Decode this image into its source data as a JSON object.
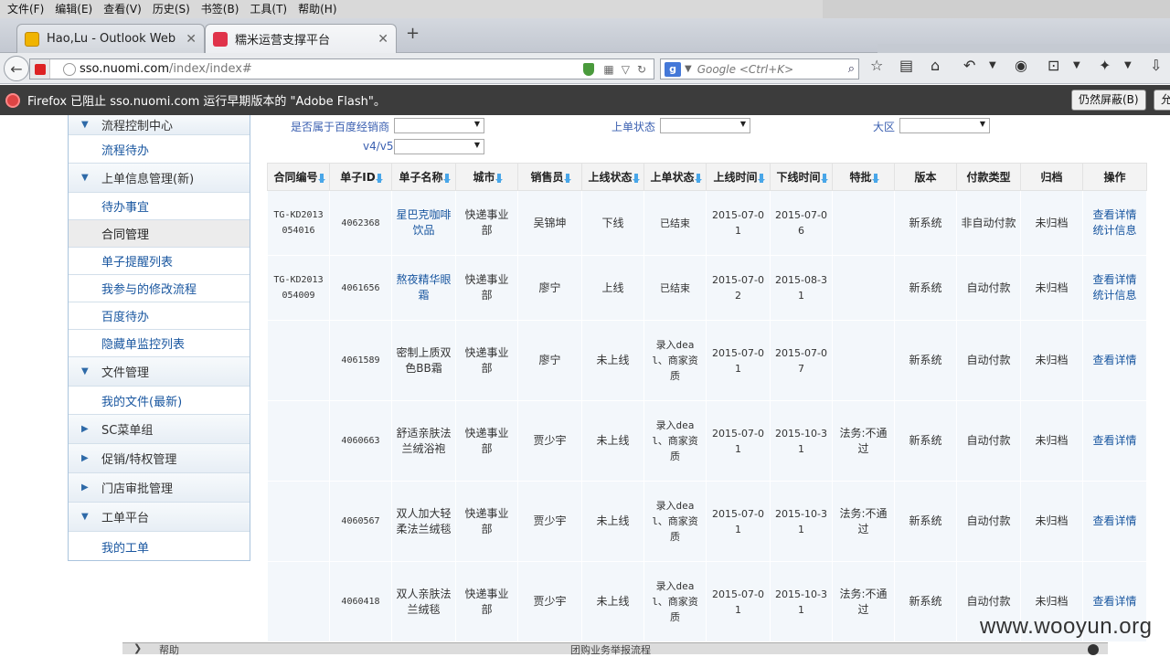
{
  "menu": [
    "文件(F)",
    "编辑(E)",
    "查看(V)",
    "历史(S)",
    "书签(B)",
    "工具(T)",
    "帮助(H)"
  ],
  "tabs": [
    {
      "title": "Hao,Lu - Outlook Web ..."
    },
    {
      "title": "糯米运营支撑平台"
    }
  ],
  "nav": {
    "url_host": "sso.nuomi.com",
    "url_path": "/index/index#",
    "search_placeholder": "Google <Ctrl+K>"
  },
  "notification": {
    "text": "Firefox 已阻止 sso.nuomi.com 运行早期版本的 \"Adobe Flash\"。",
    "button": "仍然屏蔽(B)",
    "button2": "允"
  },
  "sidebar": [
    {
      "type": "head",
      "label": "流程控制中心"
    },
    {
      "type": "item",
      "label": "流程待办"
    },
    {
      "type": "head",
      "label": "上单信息管理(新)"
    },
    {
      "type": "item",
      "label": "待办事宜"
    },
    {
      "type": "item",
      "label": "合同管理",
      "active": true
    },
    {
      "type": "item",
      "label": "单子提醒列表"
    },
    {
      "type": "item",
      "label": "我参与的修改流程"
    },
    {
      "type": "item",
      "label": "百度待办"
    },
    {
      "type": "item",
      "label": "隐藏单监控列表"
    },
    {
      "type": "head",
      "label": "文件管理"
    },
    {
      "type": "item",
      "label": "我的文件(最新)"
    },
    {
      "type": "head",
      "label": "SC菜单组",
      "collapsed": true
    },
    {
      "type": "head",
      "label": "促销/特权管理",
      "collapsed": true
    },
    {
      "type": "head",
      "label": "门店审批管理",
      "collapsed": true
    },
    {
      "type": "head",
      "label": "工单平台"
    },
    {
      "type": "item",
      "label": "我的工单"
    }
  ],
  "filters": {
    "baidu_dealer_label": "是否属于百度经销商",
    "order_status_label": "上单状态",
    "region_label": "大区",
    "version_label": "v4/v5"
  },
  "table": {
    "headers": [
      "合同编号",
      "单子ID",
      "单子名称",
      "城市",
      "销售员",
      "上线状态",
      "上单状态",
      "上线时间",
      "下线时间",
      "特批",
      "版本",
      "付款类型",
      "归档",
      "操作"
    ],
    "rows": [
      {
        "contract": "TG-KD2013054016",
        "id": "4062368",
        "name": "星巴克咖啡饮品",
        "city": "快递事业部",
        "sales": "吴锦坤",
        "online": "下线",
        "status": "已结束",
        "start": "2015-07-01",
        "end": "2015-07-06",
        "special": "",
        "version": "新系统",
        "pay": "非自动付款",
        "archive": "未归档",
        "action": "查看详情 统计信息"
      },
      {
        "contract": "TG-KD2013054009",
        "id": "4061656",
        "name": "熬夜精华眼霜",
        "city": "快递事业部",
        "sales": "廖宁",
        "online": "上线",
        "status": "已结束",
        "start": "2015-07-02",
        "end": "2015-08-31",
        "special": "",
        "version": "新系统",
        "pay": "自动付款",
        "archive": "未归档",
        "action": "查看详情 统计信息"
      },
      {
        "contract": "",
        "id": "4061589",
        "name": "密制上质双色BB霜",
        "city": "快递事业部",
        "sales": "廖宁",
        "online": "未上线",
        "status": "录入deal、商家资质",
        "start": "2015-07-01",
        "end": "2015-07-07",
        "special": "",
        "version": "新系统",
        "pay": "自动付款",
        "archive": "未归档",
        "action": "查看详情"
      },
      {
        "contract": "",
        "id": "4060663",
        "name": "舒适亲肤法兰绒浴袍",
        "city": "快递事业部",
        "sales": "贾少宇",
        "online": "未上线",
        "status": "录入deal、商家资质",
        "start": "2015-07-01",
        "end": "2015-10-31",
        "special": "法务:不通过",
        "version": "新系统",
        "pay": "自动付款",
        "archive": "未归档",
        "action": "查看详情"
      },
      {
        "contract": "",
        "id": "4060567",
        "name": "双人加大轻柔法兰绒毯",
        "city": "快递事业部",
        "sales": "贾少宇",
        "online": "未上线",
        "status": "录入deal、商家资质",
        "start": "2015-07-01",
        "end": "2015-10-31",
        "special": "法务:不通过",
        "version": "新系统",
        "pay": "自动付款",
        "archive": "未归档",
        "action": "查看详情"
      },
      {
        "contract": "",
        "id": "4060418",
        "name": "双人亲肤法兰绒毯",
        "city": "快递事业部",
        "sales": "贾少宇",
        "online": "未上线",
        "status": "录入deal、商家资质",
        "start": "2015-07-01",
        "end": "2015-10-31",
        "special": "法务:不通过",
        "version": "新系统",
        "pay": "自动付款",
        "archive": "未归档",
        "action": "查看详情"
      }
    ]
  },
  "bottombar": {
    "left": "帮助",
    "middle": "团购业务举报流程"
  },
  "watermark": "www.wooyun.org"
}
